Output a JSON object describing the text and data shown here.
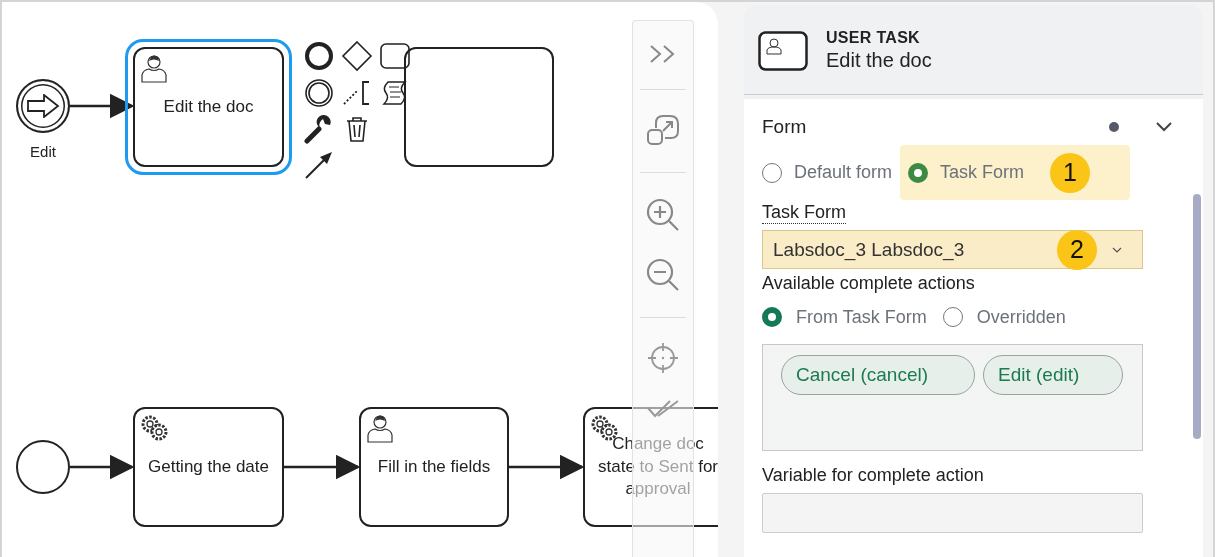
{
  "diagram": {
    "nodes": [
      {
        "kind": "message-start-event",
        "label": "Edit",
        "selected": false
      },
      {
        "kind": "user-task",
        "label": "Edit the doc",
        "selected": true
      },
      {
        "kind": "plain-task",
        "selected": false
      },
      {
        "kind": "start-event",
        "selected": false
      },
      {
        "kind": "service-task",
        "label": "Getting the date",
        "selected": false
      },
      {
        "kind": "user-task",
        "label": "Fill in the fields",
        "selected": false
      },
      {
        "kind": "service-task",
        "label": "Change doc state to Sent for approval",
        "selected": false
      }
    ]
  },
  "panel": {
    "header": {
      "type": "USER TASK",
      "name": "Edit the doc"
    },
    "section": {
      "title": "Form",
      "changed": true,
      "expanded": true
    },
    "form_type": [
      {
        "label": "Default form",
        "selected": false
      },
      {
        "label": "Task Form",
        "selected": true,
        "callout": "1"
      }
    ],
    "task_form": {
      "label": "Task Form",
      "value": "Labsdoc_3 Labsdoc_3",
      "callout": "2"
    },
    "complete_actions": {
      "label": "Available complete actions",
      "options": [
        {
          "label": "From Task Form",
          "selected": true
        },
        {
          "label": "Overridden",
          "selected": false
        }
      ],
      "tags": [
        "Cancel (cancel)",
        "Edit (edit)"
      ]
    },
    "variable": {
      "label": "Variable for complete action"
    }
  }
}
